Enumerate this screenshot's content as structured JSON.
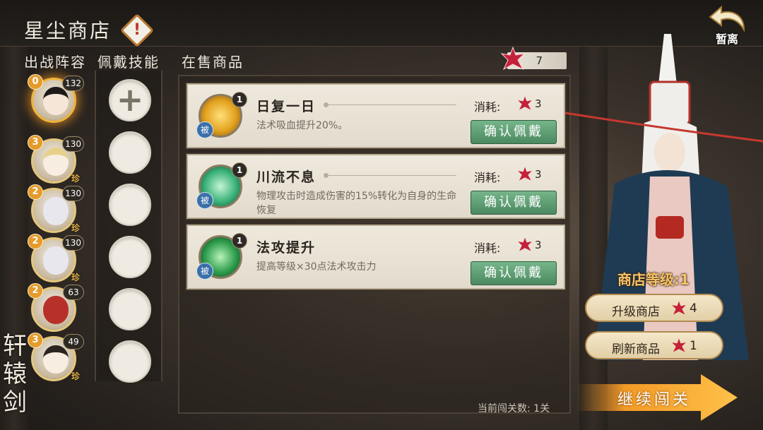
{
  "header": {
    "title": "星尘商店",
    "warn_glyph": "!",
    "exit_label": "暂离"
  },
  "columns": {
    "lineup": "出战阵容",
    "skills": "佩戴技能",
    "shop": "在售商品"
  },
  "currency": {
    "amount": "7",
    "icon": "red-crystal-icon",
    "color": "#c4213a"
  },
  "lineup": [
    {
      "stars": "0",
      "level": "132",
      "selected": true
    },
    {
      "stars": "3",
      "level": "130",
      "rare": "珍"
    },
    {
      "stars": "2",
      "level": "130",
      "rare": "珍"
    },
    {
      "stars": "2",
      "level": "130",
      "rare": "珍"
    },
    {
      "stars": "2",
      "level": "63"
    },
    {
      "stars": "3",
      "level": "49",
      "rare": "珍"
    }
  ],
  "skill_slots": {
    "add_glyph": "+",
    "count": 6
  },
  "items": [
    {
      "name": "日复一日",
      "desc": "法术吸血提升20%。",
      "count": "1",
      "passive": "被",
      "cost_label": "消耗:",
      "cost": "3",
      "button": "确认佩戴",
      "icon_color": "#e2a21f"
    },
    {
      "name": "川流不息",
      "desc": "物理攻击时造成伤害的15%转化为自身的生命恢复",
      "count": "1",
      "passive": "被",
      "cost_label": "消耗:",
      "cost": "3",
      "button": "确认佩戴",
      "icon_color": "#3cb37a"
    },
    {
      "name": "法攻提升",
      "desc": "提高等级×30点法术攻击力",
      "count": "1",
      "passive": "被",
      "cost_label": "消耗:",
      "cost": "3",
      "button": "确认佩戴",
      "icon_color": "#2e9d4c"
    }
  ],
  "shop": {
    "level_label": "商店等级:1",
    "upgrade": {
      "label": "升级商店",
      "cost": "4"
    },
    "refresh": {
      "label": "刷新商品",
      "cost": "1"
    }
  },
  "footer": {
    "progress": "当前闯关数: 1关",
    "continue": "继续闯关"
  },
  "logo": {
    "text": "轩辕剑"
  }
}
